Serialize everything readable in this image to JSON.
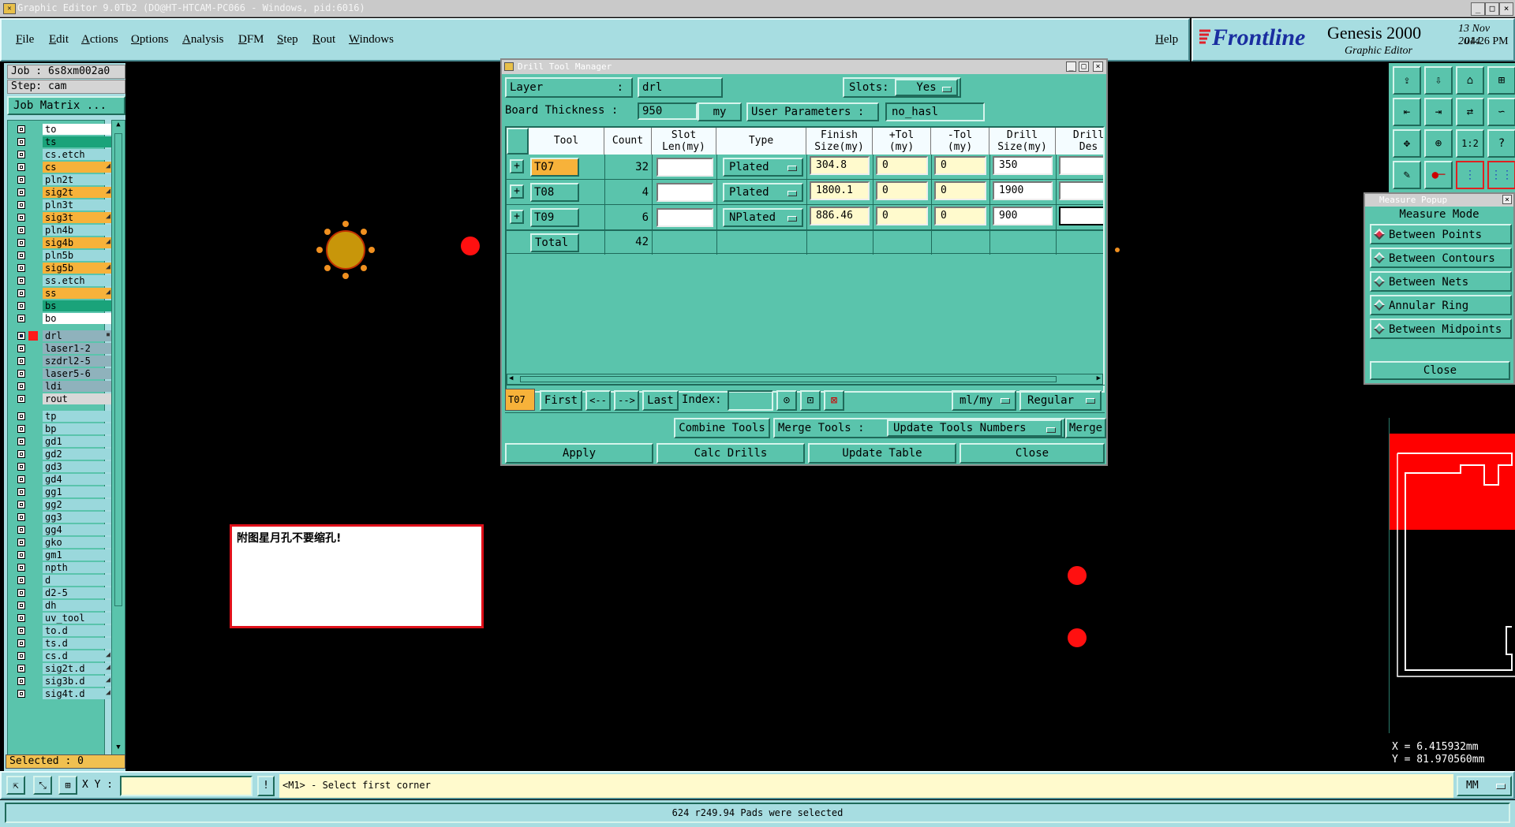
{
  "titlebar": {
    "text": "Graphic Editor 9.0Tb2 (DO@HT-HTCAM-PC066 - Windows, pid:6016)",
    "controls": [
      "_",
      "□",
      "×"
    ]
  },
  "menubar": {
    "items": [
      "File",
      "Edit",
      "Actions",
      "Options",
      "Analysis",
      "DFM",
      "Step",
      "Rout",
      "Windows"
    ],
    "help": "Help"
  },
  "branding": {
    "logo": "Frontline",
    "product": "Genesis 2000",
    "subtitle": "Graphic Editor",
    "date": "13 Nov 2014",
    "time": "04:26 PM"
  },
  "leftpanel": {
    "job": "Job : 6s8xm002a0",
    "step": "Step: cam",
    "job_matrix": "Job Matrix ...",
    "selected": "Selected : 0",
    "layers": [
      {
        "name": "to",
        "color": "#ffffff"
      },
      {
        "name": "ts",
        "color": "#1aa37a"
      },
      {
        "name": "cs.etch",
        "color": "#9ad8dc"
      },
      {
        "name": "cs",
        "color": "#f7b23a",
        "mark": "◢"
      },
      {
        "name": "pln2t",
        "color": "#9ad8dc"
      },
      {
        "name": "sig2t",
        "color": "#f7b23a",
        "mark": "◢"
      },
      {
        "name": "pln3t",
        "color": "#9ad8dc"
      },
      {
        "name": "sig3t",
        "color": "#f7b23a",
        "mark": "◢"
      },
      {
        "name": "pln4b",
        "color": "#9ad8dc"
      },
      {
        "name": "sig4b",
        "color": "#f7b23a",
        "mark": "◢"
      },
      {
        "name": "pln5b",
        "color": "#9ad8dc"
      },
      {
        "name": "sig5b",
        "color": "#f7b23a",
        "mark": "◢"
      },
      {
        "name": "ss.etch",
        "color": "#9ad8dc"
      },
      {
        "name": "ss",
        "color": "#f7b23a",
        "mark": "◢"
      },
      {
        "name": "bs",
        "color": "#1aa37a"
      },
      {
        "name": "bo",
        "color": "#ffffff"
      },
      {
        "name": "drl",
        "color": "#8fb2bc",
        "mark": "▪",
        "active": true
      },
      {
        "name": "laser1-2",
        "color": "#8fb2bc"
      },
      {
        "name": "szdrl2-5",
        "color": "#8fb2bc"
      },
      {
        "name": "laser5-6",
        "color": "#8fb2bc"
      },
      {
        "name": "ldi",
        "color": "#8fb2bc"
      },
      {
        "name": "rout",
        "color": "#d8d8d8"
      },
      {
        "name": "tp",
        "color": "#9ad8dc"
      },
      {
        "name": "bp",
        "color": "#9ad8dc"
      },
      {
        "name": "gd1",
        "color": "#9ad8dc"
      },
      {
        "name": "gd2",
        "color": "#9ad8dc"
      },
      {
        "name": "gd3",
        "color": "#9ad8dc"
      },
      {
        "name": "gd4",
        "color": "#9ad8dc"
      },
      {
        "name": "gg1",
        "color": "#9ad8dc"
      },
      {
        "name": "gg2",
        "color": "#9ad8dc"
      },
      {
        "name": "gg3",
        "color": "#9ad8dc"
      },
      {
        "name": "gg4",
        "color": "#9ad8dc"
      },
      {
        "name": "gko",
        "color": "#9ad8dc"
      },
      {
        "name": "gm1",
        "color": "#9ad8dc"
      },
      {
        "name": "npth",
        "color": "#9ad8dc"
      },
      {
        "name": "d",
        "color": "#9ad8dc"
      },
      {
        "name": "d2-5",
        "color": "#9ad8dc"
      },
      {
        "name": "dh",
        "color": "#9ad8dc"
      },
      {
        "name": "uv_tool",
        "color": "#9ad8dc"
      },
      {
        "name": "to.d",
        "color": "#9ad8dc"
      },
      {
        "name": "ts.d",
        "color": "#9ad8dc"
      },
      {
        "name": "cs.d",
        "color": "#9ad8dc",
        "mark": "◢"
      },
      {
        "name": "sig2t.d",
        "color": "#9ad8dc",
        "mark": "◢"
      },
      {
        "name": "sig3b.d",
        "color": "#9ad8dc",
        "mark": "◢"
      },
      {
        "name": "sig4t.d",
        "color": "#9ad8dc",
        "mark": "◢"
      }
    ]
  },
  "canvas": {
    "note": "附图星月孔不要缩孔!"
  },
  "dialog": {
    "title": "Drill Tool Manager",
    "layer_label": "Layer",
    "layer_value": "drl",
    "slots_label": "Slots:",
    "slots_value": "Yes",
    "thickness_label": "Board Thickness :",
    "thickness_value": "950",
    "thickness_unit": "my",
    "user_params_label": "User Parameters :",
    "user_params_value": "no_hasl",
    "headers": [
      "Tool",
      "Count",
      "Slot\nLen(my)",
      "Type",
      "Finish\nSize(my)",
      "+Tol\n(my)",
      "-Tol\n(my)",
      "Drill\nSize(my)",
      "Drill\nDes"
    ],
    "rows": [
      {
        "tool": "T07",
        "count": "32",
        "slot": "",
        "type": "Plated",
        "finish": "304.8",
        "ptol": "0",
        "ntol": "0",
        "drill": "350",
        "des": ""
      },
      {
        "tool": "T08",
        "count": "4",
        "slot": "",
        "type": "Plated",
        "finish": "1800.1",
        "ptol": "0",
        "ntol": "0",
        "drill": "1900",
        "des": ""
      },
      {
        "tool": "T09",
        "count": "6",
        "slot": "",
        "type": "NPlated",
        "finish": "886.46",
        "ptol": "0",
        "ntol": "0",
        "drill": "900",
        "des": ""
      }
    ],
    "total_label": "Total",
    "total_count": "42",
    "nav": {
      "current": "T07",
      "first": "First",
      "prev": "<--",
      "next": "-->",
      "last": "Last",
      "index_label": "Index:",
      "units": "ml/my",
      "mode": "Regular"
    },
    "actions": {
      "combine": "Combine Tools",
      "merge_label": "Merge Tools :",
      "update_numbers": "Update Tools Numbers",
      "merge": "Merge"
    },
    "buttons": {
      "apply": "Apply",
      "calc": "Calc Drills",
      "update": "Update Table",
      "close": "Close"
    }
  },
  "measure": {
    "title": "Measure Popup",
    "mode_label": "Measure Mode",
    "options": [
      "Between Points",
      "Between Contours",
      "Between Nets",
      "Annular Ring",
      "Between Midpoints"
    ],
    "selected_index": 0,
    "close": "Close"
  },
  "coords": {
    "x": "X = 6.415932mm",
    "y": "Y = 81.970560mm"
  },
  "cmdbar": {
    "xy_label": "X Y :",
    "prompt": "<M1> - Select first corner",
    "units": "MM"
  },
  "status": {
    "text": "624 r249.94 Pads were selected"
  }
}
